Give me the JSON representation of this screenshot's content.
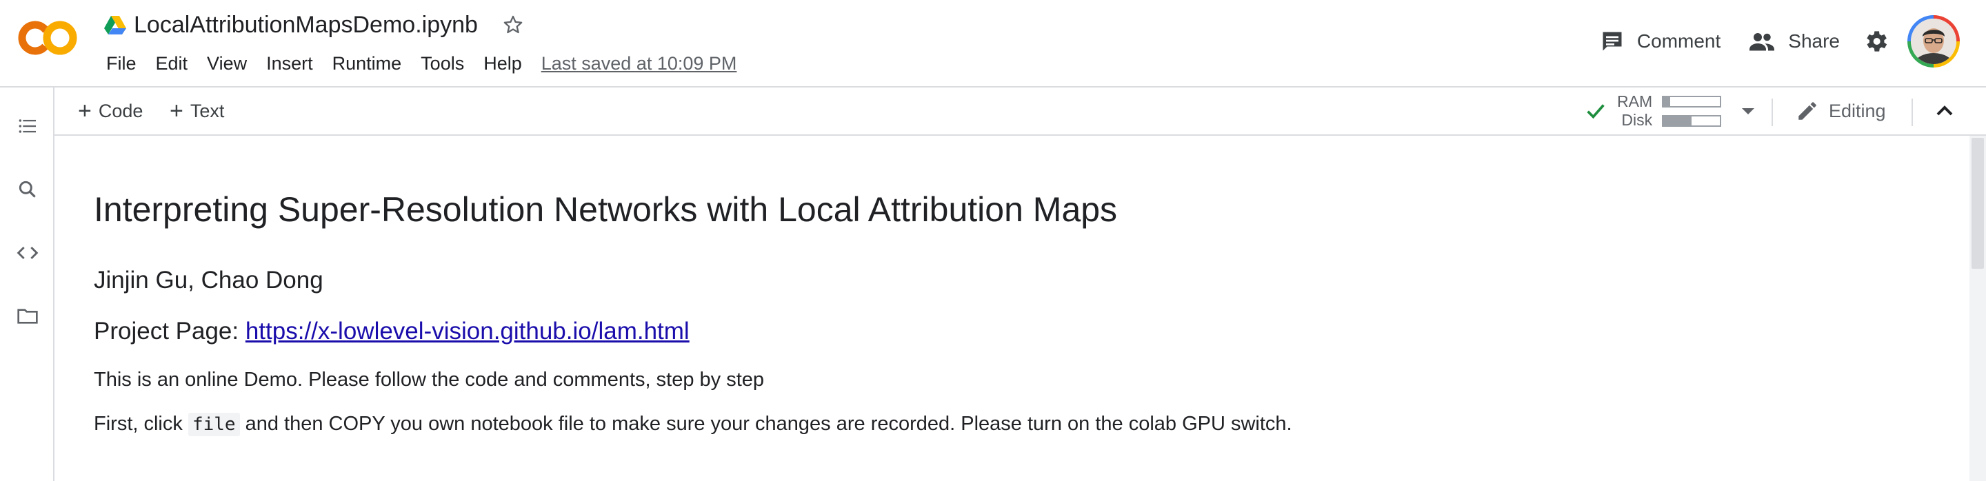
{
  "app": {
    "notebook_name": "LocalAttributionMapsDemo.ipynb",
    "menu": [
      "File",
      "Edit",
      "View",
      "Insert",
      "Runtime",
      "Tools",
      "Help"
    ],
    "last_saved": "Last saved at 10:09 PM",
    "comment_label": "Comment",
    "share_label": "Share"
  },
  "toolbar": {
    "add_code": "Code",
    "add_text": "Text",
    "ram_label": "RAM",
    "disk_label": "Disk",
    "ram_usage_fraction": 0.12,
    "disk_usage_fraction": 0.5,
    "editing_label": "Editing"
  },
  "sidebar_icons": [
    "table-of-contents-icon",
    "search-icon",
    "code-snippets-icon",
    "files-icon"
  ],
  "notebook": {
    "title": "Interpreting Super-Resolution Networks with Local Attribution Maps",
    "authors": "Jinjin Gu, Chao Dong",
    "project_label": "Project Page: ",
    "project_url": "https://x-lowlevel-vision.github.io/lam.html",
    "para1": "This is an online Demo. Please follow the code and comments, step by step",
    "para2_before": "First, click ",
    "para2_code": "file",
    "para2_after": " and then COPY you own notebook file to make sure your changes are recorded. Please turn on the colab GPU switch."
  },
  "colors": {
    "accent_orange": "#f9ab00",
    "link": "#1a0dab",
    "check_green": "#1e8e3e",
    "border": "#dadce0"
  }
}
